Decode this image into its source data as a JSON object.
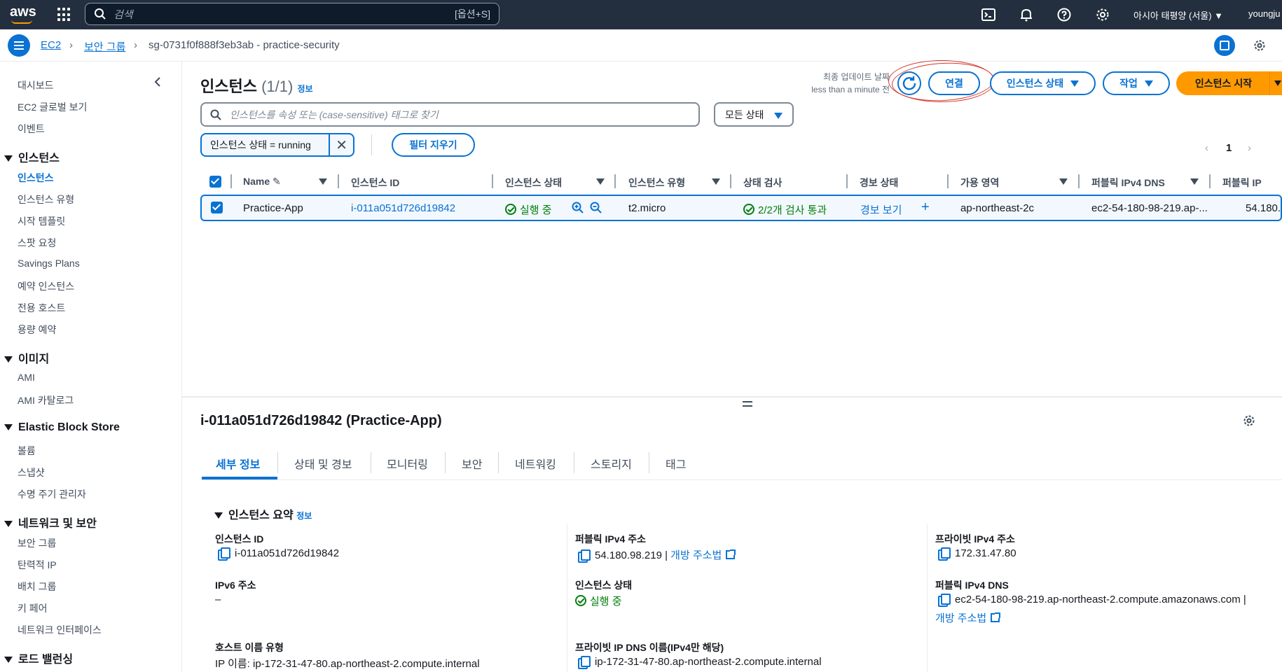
{
  "topnav": {
    "logo": "aws",
    "search_placeholder": "검색",
    "search_shortcut": "[옵션+S]",
    "region": "아시아 태평양 (서울) ▼",
    "user": "youngju"
  },
  "breadcrumb": {
    "items": [
      "EC2",
      "보안 그룹",
      "sg-0731f0f888f3eb3ab - practice-security"
    ]
  },
  "sidebar": {
    "top_items": [
      "대시보드",
      "EC2 글로벌 보기",
      "이벤트"
    ],
    "sections": [
      {
        "title": "인스턴스",
        "items": [
          "인스턴스",
          "인스턴스 유형",
          "시작 템플릿",
          "스팟 요청",
          "Savings Plans",
          "예약 인스턴스",
          "전용 호스트",
          "용량 예약"
        ]
      },
      {
        "title": "이미지",
        "items": [
          "AMI",
          "AMI 카탈로그"
        ]
      },
      {
        "title": "Elastic Block Store",
        "items": [
          "볼륨",
          "스냅샷",
          "수명 주기 관리자"
        ]
      },
      {
        "title": "네트워크 및 보안",
        "items": [
          "보안 그룹",
          "탄력적 IP",
          "배치 그룹",
          "키 페어",
          "네트워크 인터페이스"
        ]
      },
      {
        "title": "로드 밸런싱",
        "items": []
      }
    ],
    "active_item": "인스턴스"
  },
  "main": {
    "title": "인스턴스",
    "count": "(1/1)",
    "info": "정보",
    "updated_label": "최종 업데이트 날짜",
    "updated_value": "less than a minute 전",
    "connect": "연결",
    "instance_state": "인스턴스 상태",
    "actions": "작업",
    "launch": "인스턴스 시작",
    "filter_placeholder": "인스턴스를 속성 또는 (case-sensitive) 태그로 찾기",
    "state_select": "모든 상태",
    "token": "인스턴스 상태 = running",
    "clear_filters": "필터 지우기",
    "page": "1"
  },
  "table": {
    "columns": [
      "Name",
      "인스턴스 ID",
      "인스턴스 상태",
      "인스턴스 유형",
      "상태 검사",
      "경보 상태",
      "가용 영역",
      "퍼블릭 IPv4 DNS",
      "퍼블릭 IP"
    ],
    "row": {
      "name": "Practice-App",
      "id": "i-011a051d726d19842",
      "state": "실행 중",
      "type": "t2.micro",
      "check": "2/2개 검사 통과",
      "alarm": "경보 보기",
      "az": "ap-northeast-2c",
      "dns": "ec2-54-180-98-219.ap-...",
      "ip": "54.180."
    }
  },
  "detail": {
    "title": "i-011a051d726d19842 (Practice-App)",
    "tabs": [
      "세부 정보",
      "상태 및 경보",
      "모니터링",
      "보안",
      "네트워킹",
      "스토리지",
      "태그"
    ],
    "section": "인스턴스 요약",
    "section_info": "정보",
    "fields": {
      "instance_id_label": "인스턴스 ID",
      "instance_id": "i-011a051d726d19842",
      "public_ip_label": "퍼블릭 IPv4 주소",
      "public_ip": "54.180.98.219 |",
      "open_address": "개방 주소법",
      "private_ip_label": "프라이빗 IPv4 주소",
      "private_ip": "172.31.47.80",
      "ipv6_label": "IPv6 주소",
      "ipv6": "–",
      "state_label": "인스턴스 상태",
      "state": "실행 중",
      "public_dns_label": "퍼블릭 IPv4 DNS",
      "public_dns": "ec2-54-180-98-219.ap-northeast-2.compute.amazonaws.com |",
      "hostname_type_label": "호스트 이름 유형",
      "hostname_type": "IP 이름: ip-172-31-47-80.ap-northeast-2.compute.internal",
      "private_dns_label": "프라이빗 IP DNS 이름(IPv4만 해당)",
      "private_dns": "ip-172-31-47-80.ap-northeast-2.compute.internal"
    }
  },
  "colors": {
    "accent": "#0972d3",
    "primary": "#ff9900",
    "success": "#037f0c",
    "nav": "#232f3e",
    "annotation": "#d43a2f"
  }
}
